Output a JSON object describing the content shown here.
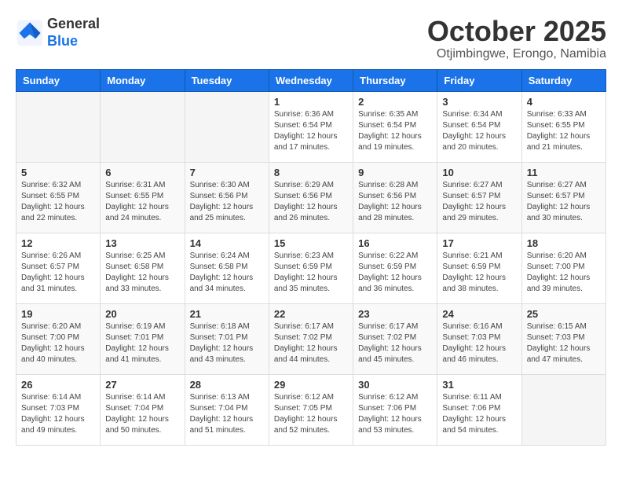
{
  "header": {
    "logo_general": "General",
    "logo_blue": "Blue",
    "month_title": "October 2025",
    "subtitle": "Otjimbingwe, Erongo, Namibia"
  },
  "weekdays": [
    "Sunday",
    "Monday",
    "Tuesday",
    "Wednesday",
    "Thursday",
    "Friday",
    "Saturday"
  ],
  "weeks": [
    [
      {
        "day": "",
        "info": ""
      },
      {
        "day": "",
        "info": ""
      },
      {
        "day": "",
        "info": ""
      },
      {
        "day": "1",
        "info": "Sunrise: 6:36 AM\nSunset: 6:54 PM\nDaylight: 12 hours\nand 17 minutes."
      },
      {
        "day": "2",
        "info": "Sunrise: 6:35 AM\nSunset: 6:54 PM\nDaylight: 12 hours\nand 19 minutes."
      },
      {
        "day": "3",
        "info": "Sunrise: 6:34 AM\nSunset: 6:54 PM\nDaylight: 12 hours\nand 20 minutes."
      },
      {
        "day": "4",
        "info": "Sunrise: 6:33 AM\nSunset: 6:55 PM\nDaylight: 12 hours\nand 21 minutes."
      }
    ],
    [
      {
        "day": "5",
        "info": "Sunrise: 6:32 AM\nSunset: 6:55 PM\nDaylight: 12 hours\nand 22 minutes."
      },
      {
        "day": "6",
        "info": "Sunrise: 6:31 AM\nSunset: 6:55 PM\nDaylight: 12 hours\nand 24 minutes."
      },
      {
        "day": "7",
        "info": "Sunrise: 6:30 AM\nSunset: 6:56 PM\nDaylight: 12 hours\nand 25 minutes."
      },
      {
        "day": "8",
        "info": "Sunrise: 6:29 AM\nSunset: 6:56 PM\nDaylight: 12 hours\nand 26 minutes."
      },
      {
        "day": "9",
        "info": "Sunrise: 6:28 AM\nSunset: 6:56 PM\nDaylight: 12 hours\nand 28 minutes."
      },
      {
        "day": "10",
        "info": "Sunrise: 6:27 AM\nSunset: 6:57 PM\nDaylight: 12 hours\nand 29 minutes."
      },
      {
        "day": "11",
        "info": "Sunrise: 6:27 AM\nSunset: 6:57 PM\nDaylight: 12 hours\nand 30 minutes."
      }
    ],
    [
      {
        "day": "12",
        "info": "Sunrise: 6:26 AM\nSunset: 6:57 PM\nDaylight: 12 hours\nand 31 minutes."
      },
      {
        "day": "13",
        "info": "Sunrise: 6:25 AM\nSunset: 6:58 PM\nDaylight: 12 hours\nand 33 minutes."
      },
      {
        "day": "14",
        "info": "Sunrise: 6:24 AM\nSunset: 6:58 PM\nDaylight: 12 hours\nand 34 minutes."
      },
      {
        "day": "15",
        "info": "Sunrise: 6:23 AM\nSunset: 6:59 PM\nDaylight: 12 hours\nand 35 minutes."
      },
      {
        "day": "16",
        "info": "Sunrise: 6:22 AM\nSunset: 6:59 PM\nDaylight: 12 hours\nand 36 minutes."
      },
      {
        "day": "17",
        "info": "Sunrise: 6:21 AM\nSunset: 6:59 PM\nDaylight: 12 hours\nand 38 minutes."
      },
      {
        "day": "18",
        "info": "Sunrise: 6:20 AM\nSunset: 7:00 PM\nDaylight: 12 hours\nand 39 minutes."
      }
    ],
    [
      {
        "day": "19",
        "info": "Sunrise: 6:20 AM\nSunset: 7:00 PM\nDaylight: 12 hours\nand 40 minutes."
      },
      {
        "day": "20",
        "info": "Sunrise: 6:19 AM\nSunset: 7:01 PM\nDaylight: 12 hours\nand 41 minutes."
      },
      {
        "day": "21",
        "info": "Sunrise: 6:18 AM\nSunset: 7:01 PM\nDaylight: 12 hours\nand 43 minutes."
      },
      {
        "day": "22",
        "info": "Sunrise: 6:17 AM\nSunset: 7:02 PM\nDaylight: 12 hours\nand 44 minutes."
      },
      {
        "day": "23",
        "info": "Sunrise: 6:17 AM\nSunset: 7:02 PM\nDaylight: 12 hours\nand 45 minutes."
      },
      {
        "day": "24",
        "info": "Sunrise: 6:16 AM\nSunset: 7:03 PM\nDaylight: 12 hours\nand 46 minutes."
      },
      {
        "day": "25",
        "info": "Sunrise: 6:15 AM\nSunset: 7:03 PM\nDaylight: 12 hours\nand 47 minutes."
      }
    ],
    [
      {
        "day": "26",
        "info": "Sunrise: 6:14 AM\nSunset: 7:03 PM\nDaylight: 12 hours\nand 49 minutes."
      },
      {
        "day": "27",
        "info": "Sunrise: 6:14 AM\nSunset: 7:04 PM\nDaylight: 12 hours\nand 50 minutes."
      },
      {
        "day": "28",
        "info": "Sunrise: 6:13 AM\nSunset: 7:04 PM\nDaylight: 12 hours\nand 51 minutes."
      },
      {
        "day": "29",
        "info": "Sunrise: 6:12 AM\nSunset: 7:05 PM\nDaylight: 12 hours\nand 52 minutes."
      },
      {
        "day": "30",
        "info": "Sunrise: 6:12 AM\nSunset: 7:06 PM\nDaylight: 12 hours\nand 53 minutes."
      },
      {
        "day": "31",
        "info": "Sunrise: 6:11 AM\nSunset: 7:06 PM\nDaylight: 12 hours\nand 54 minutes."
      },
      {
        "day": "",
        "info": ""
      }
    ]
  ]
}
